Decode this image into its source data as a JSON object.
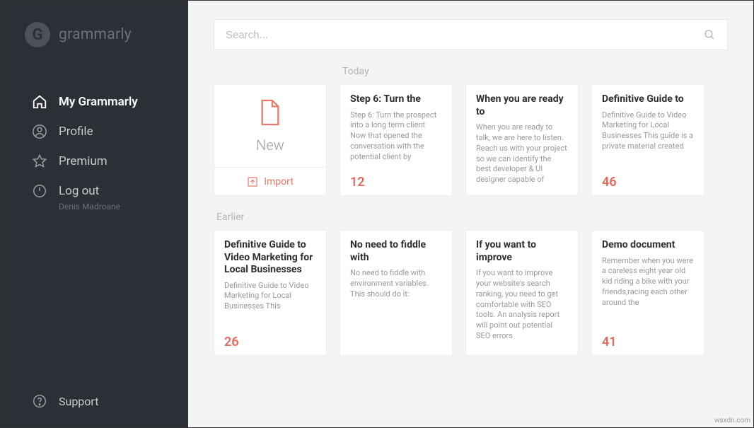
{
  "brand": {
    "name": "grammarly",
    "logo_letter": "G"
  },
  "sidebar": {
    "items": [
      {
        "label": "My Grammarly"
      },
      {
        "label": "Profile"
      },
      {
        "label": "Premium"
      },
      {
        "label": "Log out"
      }
    ],
    "user_name": "Denis Madroane",
    "support_label": "Support"
  },
  "search": {
    "placeholder": "Search..."
  },
  "sections": {
    "today_label": "Today",
    "earlier_label": "Earlier"
  },
  "new_card": {
    "new_label": "New",
    "import_label": "Import"
  },
  "today": [
    {
      "title": "Step 6: Turn the",
      "snippet": "Step 6: Turn the prospect into a long term client Now that opened the conversation with the potential client by",
      "score": "12"
    },
    {
      "title": "When you are ready to",
      "snippet": "When you are ready to talk, we are here to listen. Reach us with your project so we can identify the best developer & UI designer capable of",
      "score": ""
    },
    {
      "title": "Definitive Guide to",
      "snippet": "Definitive Guide to Video Marketing for Local Businesses This guide is a private material created",
      "score": "46"
    }
  ],
  "earlier": [
    {
      "title": "Definitive Guide to Video Marketing for Local Businesses",
      "snippet": "Definitive Guide to Video Marketing for Local Businesses This",
      "score": "26"
    },
    {
      "title": "No need to fiddle with",
      "snippet": "No need to fiddle with environment variables. This should do it:",
      "score": ""
    },
    {
      "title": "If you want to improve",
      "snippet": "If you want to improve your website's search ranking, you need to get comfortable with SEO tools. An analysis report will point out potential SEO errors",
      "score": ""
    },
    {
      "title": "Demo document",
      "snippet": "Remember when you were a careless eight year old kid riding a bike with your friends,racing each other around the",
      "score": "41"
    }
  ],
  "attribution": "wsxdn.com"
}
